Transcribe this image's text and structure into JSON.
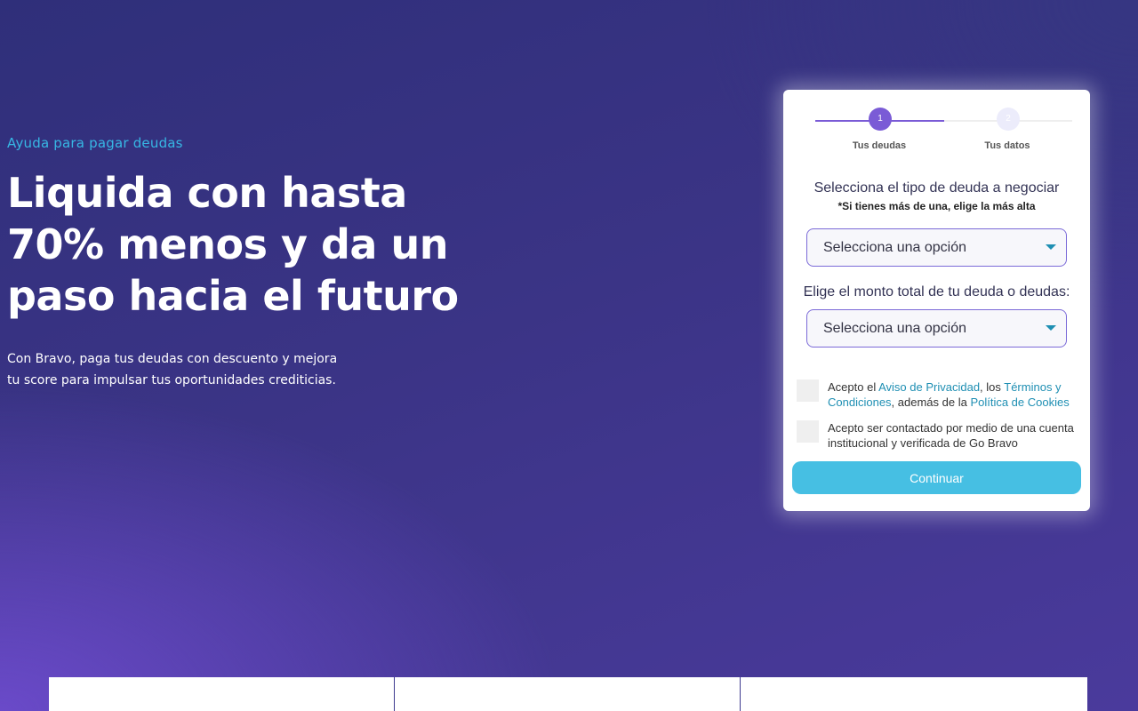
{
  "hero": {
    "eyebrow": "Ayuda para pagar deudas",
    "headline_lines": [
      "Liquida con hasta",
      "70% menos y da un",
      "paso hacia el futuro"
    ],
    "subtext_lines": [
      "Con Bravo, paga tus deudas con descuento y mejora",
      "tu score para impulsar tus oportunidades crediticias."
    ]
  },
  "form": {
    "steps": [
      {
        "number": "1",
        "label": "Tus deudas",
        "active": true
      },
      {
        "number": "2",
        "label": "Tus datos",
        "active": false
      }
    ],
    "debt_type": {
      "question": "Selecciona el tipo de deuda a negociar",
      "note": "*Si tienes más de una, elige la más alta",
      "selected": "Selecciona una opción"
    },
    "debt_amount": {
      "question": "Elige el monto total de tu deuda o deudas:",
      "selected": "Selecciona una opción"
    },
    "consent_privacy": {
      "prefix": "Acepto el ",
      "privacy_link": "Aviso de Privacidad",
      "middle": ", los ",
      "terms_link": "Términos y Condiciones",
      "suffix": ", además de la ",
      "cookies_link": "Política de Cookies"
    },
    "consent_contact": "Acepto ser contactado por medio de una cuenta institucional y verificada de Go Bravo",
    "submit_label": "Continuar"
  },
  "colors": {
    "accent": "#46bfe3",
    "step_active": "#7a5bd6",
    "eyebrow": "#37b7e4",
    "link": "#1f8fb3"
  }
}
